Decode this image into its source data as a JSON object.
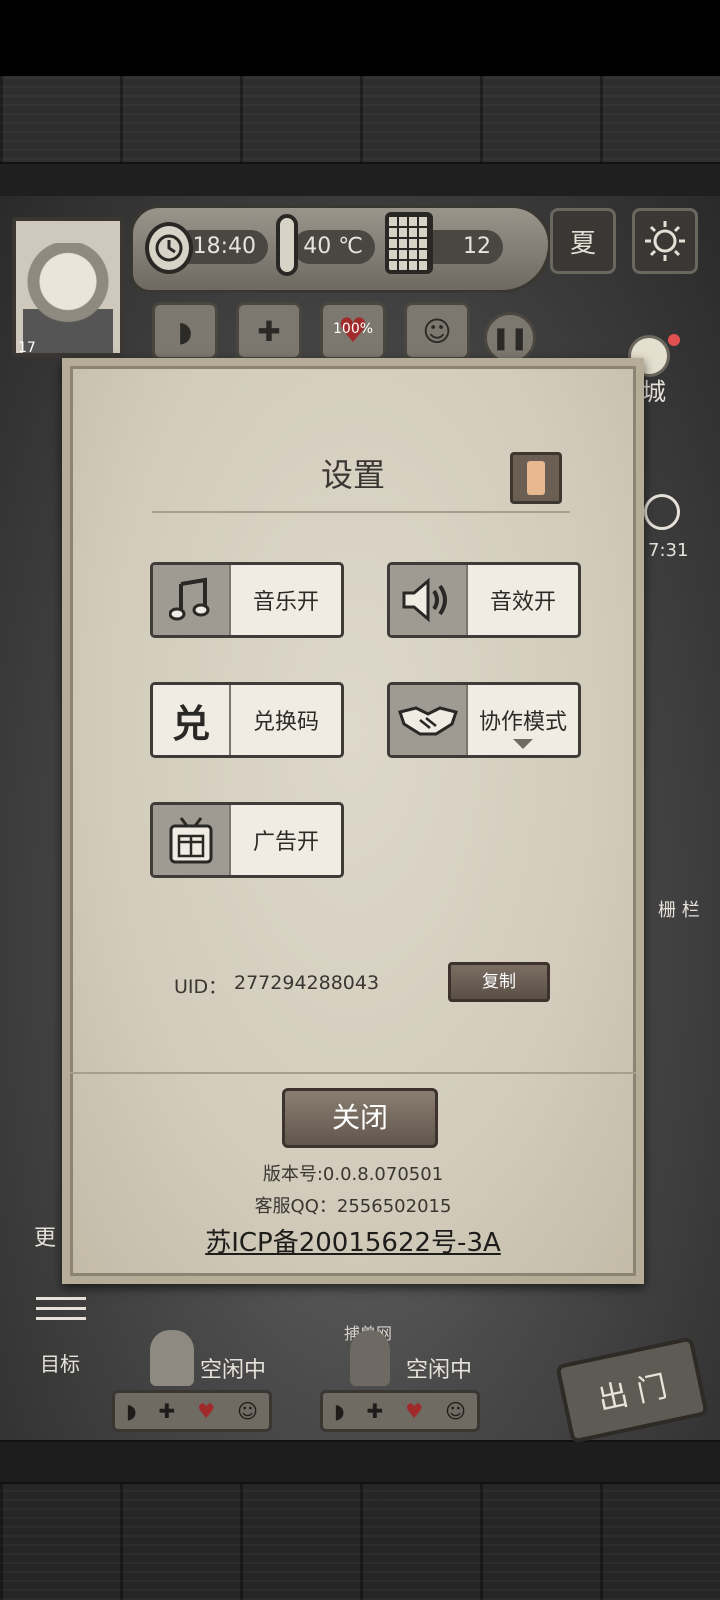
{
  "hud": {
    "time": "18:40",
    "temperature": "40 ℃",
    "day": "12",
    "season": "夏",
    "player_level": "17",
    "health_percent": "100%"
  },
  "background": {
    "side_label_right_1": "城",
    "side_label_right_2": "7:31",
    "side_label_right_3": "栅 栏",
    "side_label_left_1": "更",
    "goal_label": "目标",
    "hunt_label": "捕兽网",
    "characters": [
      {
        "status": "空闲中"
      },
      {
        "status": "空闲中"
      }
    ],
    "exit_label": "出 门"
  },
  "settings": {
    "title": "设置",
    "options": [
      {
        "label": "音乐开",
        "icon": "music-note-icon"
      },
      {
        "label": "音效开",
        "icon": "speaker-icon"
      },
      {
        "label": "兑换码",
        "icon": "redeem-icon"
      },
      {
        "label": "协作模式",
        "icon": "handshake-icon"
      },
      {
        "label": "广告开",
        "icon": "tv-gift-icon"
      }
    ],
    "uid_label": "UID：",
    "uid_value": "277294288043",
    "copy_label": "复制",
    "close_label": "关闭",
    "version": "版本号:0.0.8.070501",
    "qq": "客服QQ：2556502015",
    "icp": "苏ICP备20015622号-3A"
  },
  "colors": {
    "dialog_bg": "#d8d1c2",
    "button_brown": "#6b5e52",
    "alert_accent": "#e8b891"
  }
}
